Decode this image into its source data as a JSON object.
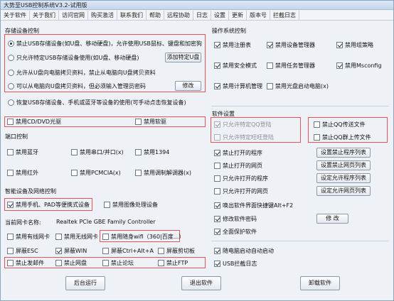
{
  "window": {
    "title": "大势至USB控制系统V3.2-试用版"
  },
  "menu": [
    "关于软件",
    "关于我们",
    "访问官网",
    "购买激活",
    "联系我们",
    "帮助",
    "远程协助",
    "日志",
    "设置",
    "更新",
    "版本号",
    "拦截日志"
  ],
  "storage": {
    "title": "存储设备控制",
    "opt1": "禁止USB存储设备(如U盘、移动硬盘)，允许使用USB鼠标、键盘和加密狗",
    "opt2": "只允许特定USB存储设备使用(如U盘、移动硬盘)",
    "opt2_btn": "添加特定U盘",
    "opt3": "允许从U盘向电脑拷贝资料，禁止从电脑向U盘拷贝资料",
    "opt4": "可以从电脑向U盘拷贝资料，但必须输入管理员密码",
    "opt4_btn": "修改",
    "opt5": "恢复USB存储设备、手机或蓝牙等设备的使用(可手动点击恢复设备)",
    "cd": "禁用CD/DVD光驱",
    "floppy": "禁用软驱"
  },
  "ports": {
    "title": "端口控制",
    "bluetooth": "禁用蓝牙",
    "serial": "禁用串口/并口(x)",
    "ieee1394": "禁用1394",
    "infrared": "禁用红外",
    "pcmcia": "禁用PCMCIA(x)",
    "modem": "禁用调制解调器(x)"
  },
  "smart": {
    "title": "智能设备及网络控制",
    "phone": "禁用手机、PAD等便携式设备",
    "imaging": "禁用图像处理设备",
    "nic_label": "当前网卡名称:",
    "nic_value": "Realtek PCIe GBE Family Controller",
    "wired": "禁用有线网卡",
    "wireless": "禁用无线网卡",
    "wifi": "禁用随身wifi（360|百度...）",
    "esc": "屏蔽ESC",
    "win": "屏蔽WIN",
    "ctrlalt": "屏蔽Ctrl+Alt+A",
    "clip": "屏蔽剪切板",
    "mail": "禁止发邮件",
    "netdisk": "禁止网盘",
    "forum": "禁止论坛",
    "ftp": "禁止FTP"
  },
  "os": {
    "title": "操作系统控制",
    "regedit": "禁用注册表",
    "devmgr": "禁用设备管理器",
    "gpedit": "禁用组策略",
    "safemode": "禁用安全模式",
    "taskmgr": "禁用任务管理器",
    "msconfig": "禁用Msconfig",
    "compmgmt": "禁用计算机管理",
    "cdboot": "禁用光盘启动电脑(x)"
  },
  "software": {
    "title": "软件设置",
    "qq_allow": "只允许特定QQ登陆",
    "qq_block": "禁止QQ传送文件",
    "ww_allow": "只允许特定旺旺登陆",
    "qq_upload": "禁止QQ群上传文件",
    "block_prog": "禁止打开的程序",
    "block_prog_btn": "设置禁止程序列表",
    "block_web": "禁止打开的网页",
    "block_web_btn": "设置禁止网页列表",
    "allow_prog": "只允许打开的程序",
    "allow_prog_btn": "设定允许程序列表",
    "allow_web": "只允许打开的网页",
    "allow_web_btn": "设定允许网页列表",
    "hotkey": "唤出软件界面快捷键Alt+F2",
    "pwd": "修改软件密码",
    "pwd_btn": "修 改",
    "protect": "全面保护软件",
    "autostart": "随电脑启动自动启动",
    "usblog": "USB拦截日志"
  },
  "buttons": {
    "background": "后台运行",
    "exit": "退出软件",
    "uninstall": "卸载软件"
  }
}
